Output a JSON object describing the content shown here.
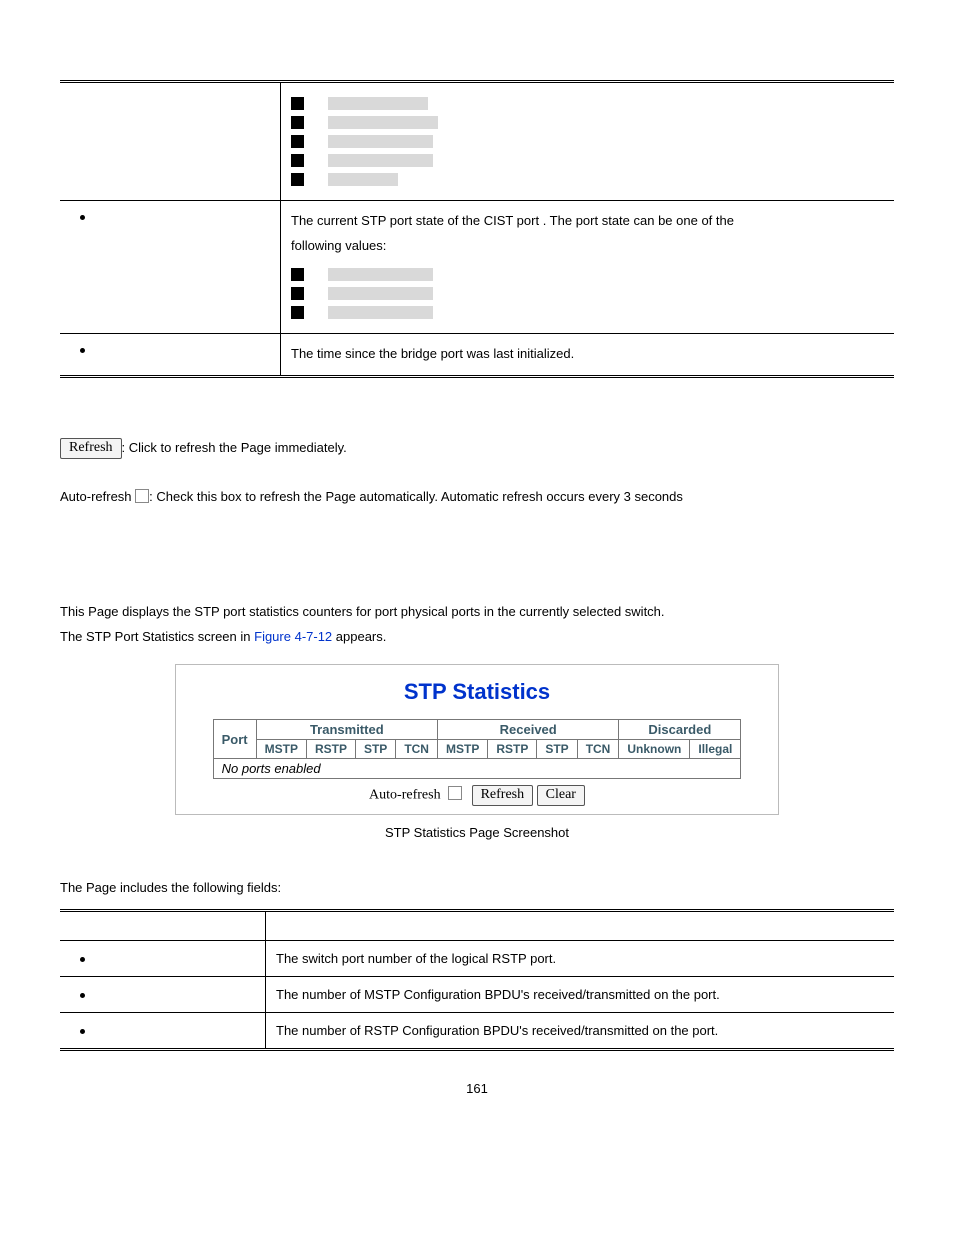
{
  "top_table": {
    "row_state": {
      "desc_line1": "The current STP port state of the CIST port . The port state can be one of the",
      "desc_line2": "following values:"
    },
    "row_uptime": {
      "desc": "The time since the bridge port was last initialized."
    }
  },
  "refresh": {
    "button": "Refresh",
    "desc": ": Click to refresh the Page immediately."
  },
  "autorefresh": {
    "label": "Auto-refresh ",
    "desc": ": Check this box to refresh the Page automatically. Automatic refresh occurs every 3 seconds"
  },
  "intro": {
    "line1": "This Page displays the STP port statistics counters for port physical ports in the currently selected switch.",
    "line2a": "The STP Port Statistics screen in ",
    "line2_link": "Figure 4-7-12",
    "line2b": " appears."
  },
  "fig": {
    "title": "STP Statistics",
    "port": "Port",
    "transmitted": "Transmitted",
    "received": "Received",
    "discarded": "Discarded",
    "mstp": "MSTP",
    "rstp": "RSTP",
    "stp": "STP",
    "tcn": "TCN",
    "unknown": "Unknown",
    "illegal": "Illegal",
    "noports": "No ports enabled",
    "autorefresh": "Auto-refresh",
    "refresh": "Refresh",
    "clear": "Clear"
  },
  "caption": "STP Statistics Page Screenshot",
  "fields_intro": "The Page includes the following fields:",
  "fields": {
    "port": "The switch port number of the logical RSTP port.",
    "mstp": "The number of MSTP Configuration BPDU's received/transmitted on the port.",
    "rstp": "The number of RSTP Configuration BPDU's received/transmitted on the port."
  },
  "page_num": "161"
}
